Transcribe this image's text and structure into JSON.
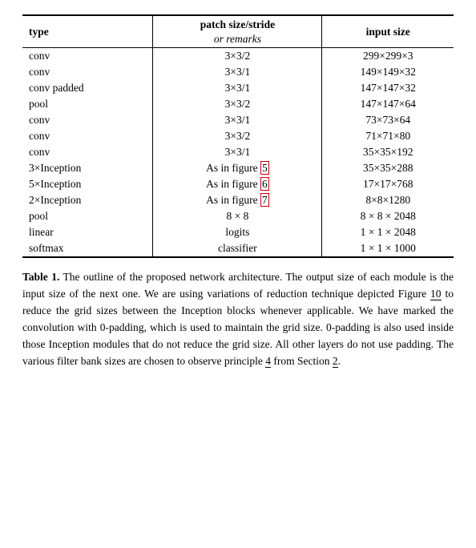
{
  "table": {
    "headers": {
      "type": "type",
      "patch": "patch size/stride",
      "patch_sub": "or remarks",
      "input": "input size"
    },
    "rows": [
      {
        "type": "conv",
        "patch": "3×3/2",
        "input": "299×299×3"
      },
      {
        "type": "conv",
        "patch": "3×3/1",
        "input": "149×149×32"
      },
      {
        "type": "conv padded",
        "patch": "3×3/1",
        "input": "147×147×32"
      },
      {
        "type": "pool",
        "patch": "3×3/2",
        "input": "147×147×64"
      },
      {
        "type": "conv",
        "patch": "3×3/1",
        "input": "73×73×64"
      },
      {
        "type": "conv",
        "patch": "3×3/2",
        "input": "71×71×80"
      },
      {
        "type": "conv",
        "patch": "3×3/1",
        "input": "35×35×192"
      },
      {
        "type": "3×Inception",
        "patch": "As in figure 5",
        "patch_ref": "5",
        "input": "35×35×288"
      },
      {
        "type": "5×Inception",
        "patch": "As in figure 6",
        "patch_ref": "6",
        "input": "17×17×768"
      },
      {
        "type": "2×Inception",
        "patch": "As in figure 7",
        "patch_ref": "7",
        "input": "8×8×1280"
      },
      {
        "type": "pool",
        "patch": "8 × 8",
        "input": "8 × 8 × 2048"
      },
      {
        "type": "linear",
        "patch": "logits",
        "input": "1 × 1 × 2048"
      },
      {
        "type": "softmax",
        "patch": "classifier",
        "input": "1 × 1 × 1000"
      }
    ]
  },
  "caption": {
    "label": "Table 1.",
    "text": " The outline of the proposed network architecture.  The output size of each module is the input size of the next one.  We are using variations of reduction technique depicted Figure ",
    "ref1": "10",
    "text2": " to reduce the grid sizes between the Inception blocks whenever applicable.  We have marked the convolution with 0-padding, which is used to maintain the grid size.  0-padding is also used inside those Inception modules that do not reduce the grid size.  All other layers do not use padding.  The various filter bank sizes are chosen to observe principle ",
    "ref2": "4",
    "text3": " from Section ",
    "ref3": "2",
    "text4": "."
  }
}
